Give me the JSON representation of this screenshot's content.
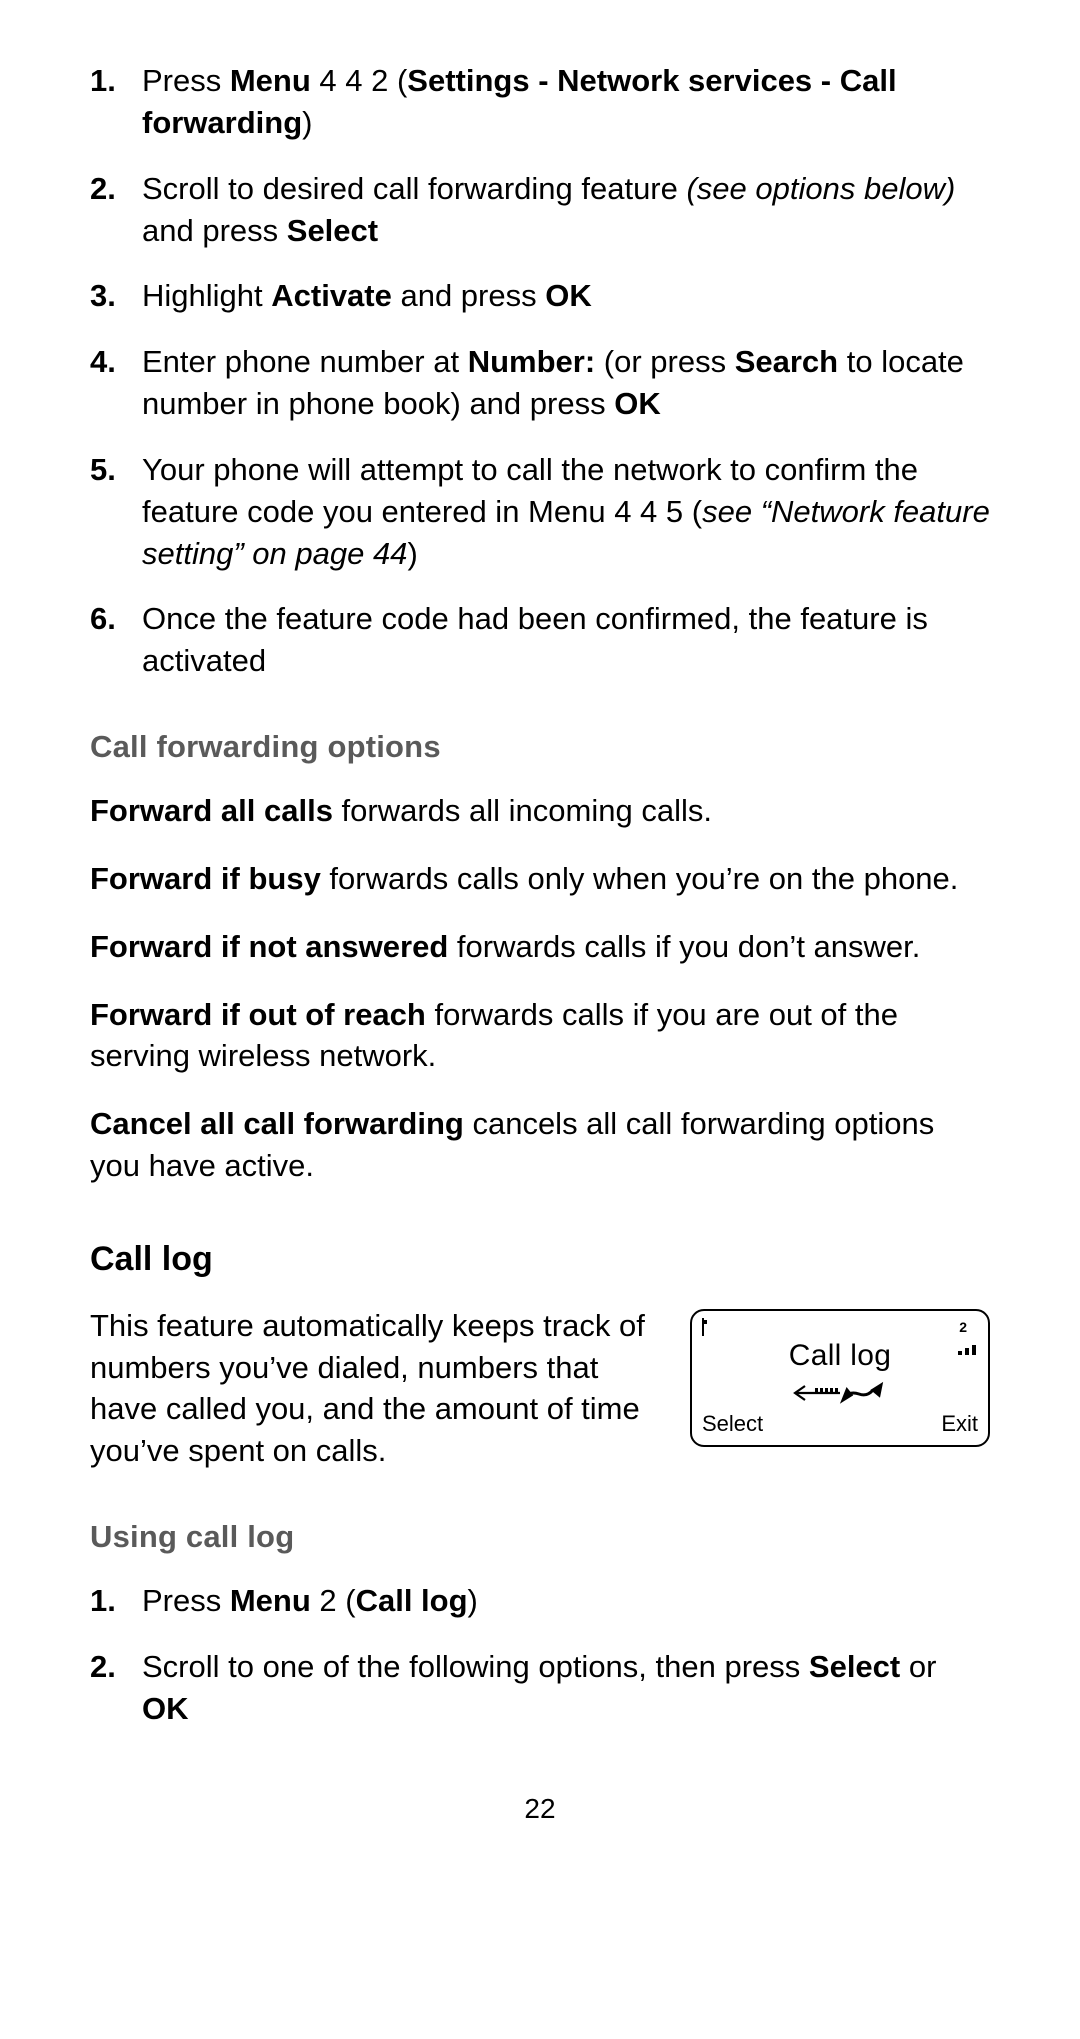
{
  "steps1": [
    {
      "n": "1.",
      "parts": [
        {
          "t": "Press "
        },
        {
          "t": "Menu",
          "b": true
        },
        {
          "t": " 4 4 2 ("
        },
        {
          "t": "Settings - Network services - Call forwarding",
          "b": true
        },
        {
          "t": ")"
        }
      ]
    },
    {
      "n": "2.",
      "parts": [
        {
          "t": "Scroll to desired call forwarding feature "
        },
        {
          "t": "(see options below)",
          "i": true
        },
        {
          "t": " and press "
        },
        {
          "t": "Select",
          "b": true
        }
      ]
    },
    {
      "n": "3.",
      "parts": [
        {
          "t": "Highlight "
        },
        {
          "t": "Activate",
          "b": true
        },
        {
          "t": " and press "
        },
        {
          "t": "OK",
          "b": true
        }
      ]
    },
    {
      "n": "4.",
      "parts": [
        {
          "t": "Enter phone number at "
        },
        {
          "t": "Number:",
          "b": true
        },
        {
          "t": " (or press "
        },
        {
          "t": "Search",
          "b": true
        },
        {
          "t": " to locate number in phone book) and press "
        },
        {
          "t": "OK",
          "b": true
        }
      ]
    },
    {
      "n": "5.",
      "parts": [
        {
          "t": "Your phone will attempt to call the network to confirm the feature code you entered in Menu 4 4 5 ("
        },
        {
          "t": "see “Network feature setting” on page 44",
          "i": true
        },
        {
          "t": ")"
        }
      ]
    },
    {
      "n": "6.",
      "parts": [
        {
          "t": "Once the feature code had been confirmed, the feature is activated"
        }
      ]
    }
  ],
  "subhead1": "Call forwarding options",
  "options": [
    [
      {
        "t": "Forward all calls",
        "b": true
      },
      {
        "t": " forwards all incoming calls."
      }
    ],
    [
      {
        "t": "Forward if busy",
        "b": true
      },
      {
        "t": " forwards calls only when you’re on the phone."
      }
    ],
    [
      {
        "t": "Forward if not answered",
        "b": true
      },
      {
        "t": " forwards calls if you don’t answer."
      }
    ],
    [
      {
        "t": "Forward if out of reach",
        "b": true
      },
      {
        "t": " forwards calls if you are out of the serving wireless network."
      }
    ],
    [
      {
        "t": "Cancel all call forwarding",
        "b": true
      },
      {
        "t": " cancels all call forwarding options you have active."
      }
    ]
  ],
  "sechead1": "Call log",
  "calllog_para": "This feature automatically keeps track of numbers you’ve dialed, numbers that have called you, and the amount of time you’ve spent on calls.",
  "phone": {
    "top_right": "2",
    "title": "Call log",
    "left": "Select",
    "right": "Exit"
  },
  "subhead2": "Using call log",
  "steps2": [
    {
      "n": "1.",
      "parts": [
        {
          "t": "Press "
        },
        {
          "t": "Menu",
          "b": true
        },
        {
          "t": " 2 ("
        },
        {
          "t": "Call log",
          "b": true
        },
        {
          "t": ")"
        }
      ]
    },
    {
      "n": "2.",
      "parts": [
        {
          "t": "Scroll to one of the following options, then press "
        },
        {
          "t": "Select",
          "b": true
        },
        {
          "t": " or "
        },
        {
          "t": "OK",
          "b": true
        }
      ]
    }
  ],
  "page_number": "22"
}
